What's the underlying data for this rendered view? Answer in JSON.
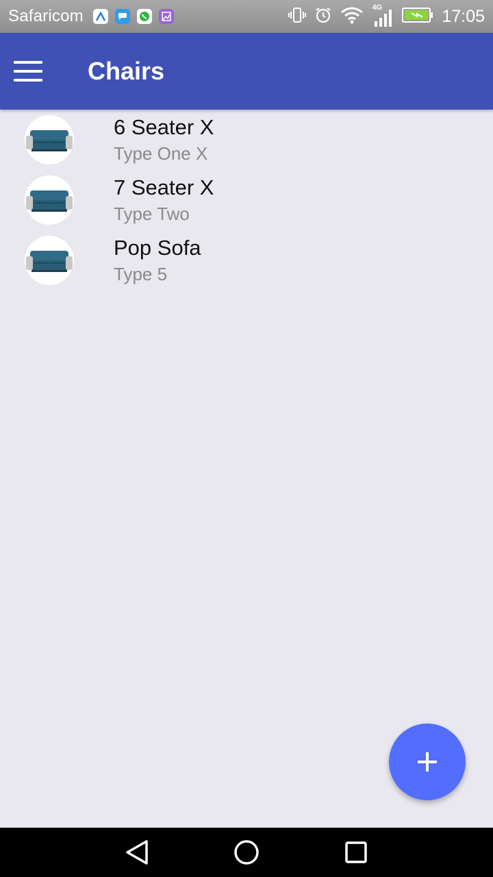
{
  "status_bar": {
    "carrier": "Safaricom",
    "network": "4G",
    "time": "17:05",
    "notification_icons": [
      "arrow-icon",
      "chat-icon",
      "whatsapp-icon",
      "gallery-icon"
    ]
  },
  "app_bar": {
    "title": "Chairs",
    "menu_icon": "hamburger-icon"
  },
  "items": [
    {
      "title": "6 Seater X",
      "subtitle": "Type One X"
    },
    {
      "title": "7 Seater X",
      "subtitle": "Type Two"
    },
    {
      "title": "Pop Sofa",
      "subtitle": "Type 5"
    }
  ],
  "fab": {
    "icon": "plus-icon",
    "color": "#536dfe"
  },
  "colors": {
    "primary": "#3f51b5",
    "background": "#e9e8ef"
  }
}
